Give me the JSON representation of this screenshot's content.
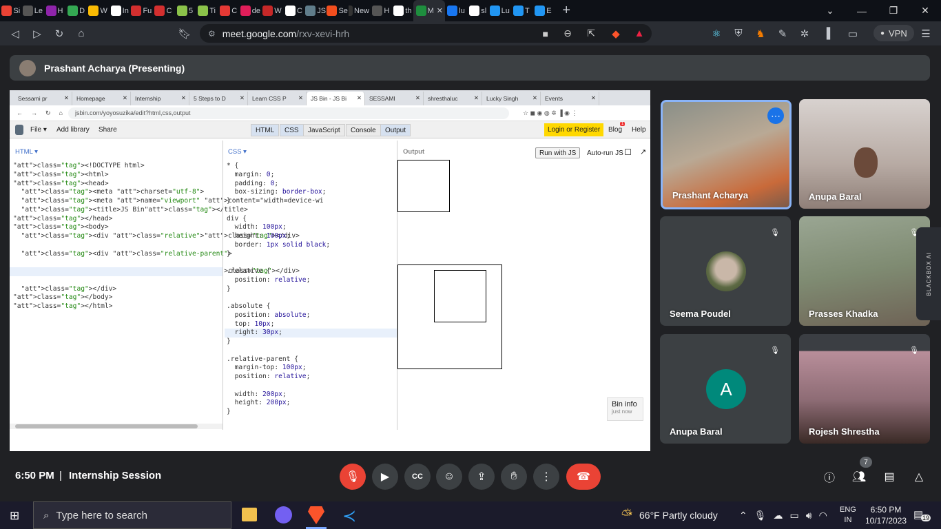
{
  "browser": {
    "tabs": [
      {
        "label": "Si",
        "color": "#ea4335"
      },
      {
        "label": "Le",
        "color": "#555"
      },
      {
        "label": "H",
        "color": "#8e24aa"
      },
      {
        "label": "D",
        "color": "#34a853"
      },
      {
        "label": "W",
        "color": "#fbbc04"
      },
      {
        "label": "In",
        "color": "#fff"
      },
      {
        "label": "Fu",
        "color": "#d32f2f"
      },
      {
        "label": "C",
        "color": "#d32f2f"
      },
      {
        "label": "5",
        "color": "#8bc34a"
      },
      {
        "label": "Ti",
        "color": "#8bc34a"
      },
      {
        "label": "C",
        "color": "#e53935"
      },
      {
        "label": "de",
        "color": "#e01e5a"
      },
      {
        "label": "W",
        "color": "#c62828"
      },
      {
        "label": "C",
        "color": "#fff"
      },
      {
        "label": "JS",
        "color": "#607d8b"
      },
      {
        "label": "Se",
        "color": "#f24e1e"
      },
      {
        "label": "New T",
        "color": "#333"
      },
      {
        "label": "H",
        "color": "#555"
      },
      {
        "label": "th",
        "color": "#fff"
      },
      {
        "label": "M",
        "color": "#1e8e3e",
        "active": true
      },
      {
        "label": "lu",
        "color": "#1877f2"
      },
      {
        "label": "sl",
        "color": "#fff"
      },
      {
        "label": "Lu",
        "color": "#2196f3"
      },
      {
        "label": "T",
        "color": "#2196f3"
      },
      {
        "label": "E",
        "color": "#2196f3"
      }
    ],
    "close_tab_icon": "✕",
    "new_tab_icon": "+",
    "url_domain": "meet.google.com",
    "url_path": "/rxv-xevi-hrh",
    "vpn_label": "VPN"
  },
  "meet": {
    "presenter_bar": "Prashant Acharya (Presenting)",
    "clock": "6:50 PM",
    "separator": "|",
    "meeting_title": "Internship Session",
    "participant_count": "7",
    "participants": [
      {
        "name": "Prashant Acharya"
      },
      {
        "name": "Anupa Baral"
      },
      {
        "name": "Seema Poudel"
      },
      {
        "name": "Prasses Khadka"
      },
      {
        "name": "Anupa Baral",
        "initial": "A"
      },
      {
        "name": "Rojesh Shrestha"
      }
    ],
    "blackbox_label": "BLACKBOX AI"
  },
  "shared_screen": {
    "tabs": [
      "Sessami pr",
      "Homepage",
      "Internship",
      "5 Steps to D",
      "Learn CSS P",
      "JS Bin - JS Bi",
      "SESSAMI",
      "shresthaluc",
      "Lucky Singh",
      "Events"
    ],
    "url": "jsbin.com/yoyosuzika/edit?html,css,output",
    "menu": {
      "file": "File ▾",
      "add_library": "Add library",
      "share": "Share"
    },
    "panels": [
      "HTML",
      "CSS",
      "JavaScript",
      "Console",
      "Output"
    ],
    "login": "Login or Register",
    "blog": "Blog",
    "blog_badge": "1",
    "help": "Help",
    "html_label": "HTML ▾",
    "css_label": "CSS ▾",
    "output_label": "Output",
    "run_btn": "Run with JS",
    "autorun": "Auto-run JS",
    "bin_info": "Bin info",
    "bin_info_sub": "just now",
    "html_code": [
      "<!DOCTYPE html>",
      "<html>",
      "<head>",
      "  <meta charset=\"utf-8\">",
      "  <meta name=\"viewport\" content=\"width=device-wi",
      "  <title>JS Bin</title>",
      "</head>",
      "<body>",
      "  <div class=\"relative\"></div>",
      "",
      "  <div class=\"relative-parent\">",
      "",
      "  <div class=\"absolute\"></div>",
      "",
      "  </div>",
      "</body>",
      "</html>"
    ],
    "css_code": [
      "* {",
      "  margin: 0;",
      "  padding: 0;",
      "  box-sizing: border-box;",
      "}",
      "",
      "div {",
      "  width: 100px;",
      "  height: 100px;",
      "  border: 1px solid black;",
      "}",
      "",
      ".relative {",
      "  position: relative;",
      "}",
      "",
      ".absolute {",
      "  position: absolute;",
      "  top: 10px;",
      "  right: 30px;",
      "}",
      "",
      ".relative-parent {",
      "  margin-top: 100px;",
      "  position: relative;",
      "",
      "  width: 200px;",
      "  height: 200px;",
      "}"
    ]
  },
  "taskbar": {
    "search_placeholder": "Type here to search",
    "weather": "66°F  Partly cloudy",
    "lang_top": "ENG",
    "lang_bottom": "IN",
    "time": "6:50 PM",
    "date": "10/17/2023",
    "notif_count": "19"
  }
}
